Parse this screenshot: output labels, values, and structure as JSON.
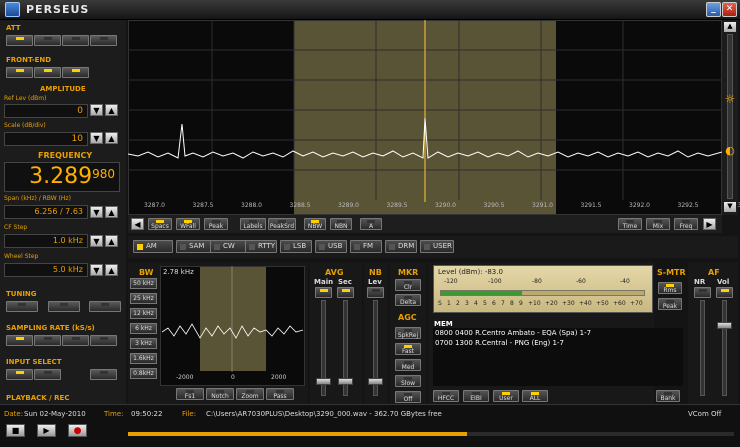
{
  "title": "PERSEUS",
  "attenuator": {
    "label": "ATT",
    "buttons": 4
  },
  "frontend": {
    "label": "FRONT-END",
    "buttons": 3
  },
  "amplitude": {
    "label": "AMPLITUDE",
    "ref_label": "Ref Lev (dBm)",
    "ref_value": "0",
    "scale_label": "Scale (dB/div)",
    "scale_value": "10"
  },
  "frequency": {
    "label": "FREQUENCY",
    "main": "3.289",
    "fine": "980",
    "span_label": "Span (kHz) / RBW (Hz)",
    "span_value": "6.256 / 7.63",
    "cf_label": "CF Step",
    "cf_value": "1.0 kHz",
    "wheel_label": "Wheel Step",
    "wheel_value": "5.0 kHz"
  },
  "tuning": {
    "label": "TUNING",
    "buttons": 3
  },
  "sampling": {
    "label": "SAMPLING RATE (kS/s)",
    "buttons": 4
  },
  "input": {
    "label": "INPUT SELECT",
    "buttons": 3
  },
  "playback": {
    "label": "PLAYBACK / REC"
  },
  "spectrum": {
    "ticks": [
      "3287.0",
      "3287.5",
      "3288.0",
      "3288.5",
      "3289.0",
      "3289.5",
      "3290.0",
      "3290.5",
      "3291.0",
      "3291.5",
      "3292.0",
      "3292.5",
      "3293.0"
    ],
    "buttons_left": [
      "Spacs",
      "WFall",
      "Peak",
      "Labels",
      "PeakSrd",
      "NBW",
      "NBN",
      "A"
    ],
    "buttons_right": [
      "Time",
      "Mix",
      "Freq"
    ]
  },
  "modes": [
    "AM",
    "SAM",
    "CW",
    "RTTY",
    "LSB",
    "USB",
    "FM",
    "DRM",
    "USER"
  ],
  "bw": {
    "label": "BW",
    "value": "2.78 kHz",
    "items": [
      "50 kHz",
      "25 kHz",
      "12 kHz",
      "6 kHz",
      "3 kHz",
      "1.6kHz",
      "0.8kHz"
    ],
    "ticks": [
      "-2000",
      "0",
      "2000"
    ],
    "buttons": [
      "Fs1",
      "Notch",
      "Zoom",
      "Pass"
    ]
  },
  "avg": {
    "label": "AVG",
    "main": "Main",
    "sec": "Sec"
  },
  "nb": {
    "label": "NB",
    "lev": "Lev"
  },
  "mkr": {
    "label": "MKR",
    "items": [
      "Clr",
      "Delta"
    ]
  },
  "agc": {
    "label": "AGC",
    "items": [
      "SpkRej",
      "Fast",
      "Med",
      "Slow",
      "Off"
    ]
  },
  "level": {
    "label": "Level (dBm): -83.0",
    "dbm": [
      "-120",
      "-100",
      "-80",
      "-60",
      "-40"
    ],
    "s": [
      "S",
      "1",
      "2",
      "3",
      "4",
      "5",
      "6",
      "7",
      "8",
      "9",
      "+10",
      "+20",
      "+30",
      "+40",
      "+50",
      "+60",
      "+70"
    ],
    "fraction": 0.4
  },
  "smtr": {
    "label": "S-MTR",
    "items": [
      "Rms",
      "Peak"
    ]
  },
  "af": {
    "label": "AF",
    "nr": "NR",
    "vol": "Vol"
  },
  "mem": {
    "label": "MEM",
    "rows": [
      "0800 0400 R.Centro Ambato - EQA (Spa)  1-7",
      "0700 1300 R.Central - PNG (Eng)  1-7"
    ],
    "buttons": [
      "HFCC",
      "EIBI",
      "User",
      "ALL",
      "Bank"
    ]
  },
  "status": {
    "date_label": "Date:",
    "date": "Sun 02-May-2010",
    "time_label": "Time:",
    "time": "09:50:22",
    "file_label": "File:",
    "file": "C:\\Users\\AR7030PLUS\\Desktop\\3290_000.wav - 362.70 GBytes free",
    "vcom": "VCom Off"
  },
  "colors": {
    "accent": "#e8a000",
    "passband": "#5a5436",
    "trace": "#ffffff"
  }
}
